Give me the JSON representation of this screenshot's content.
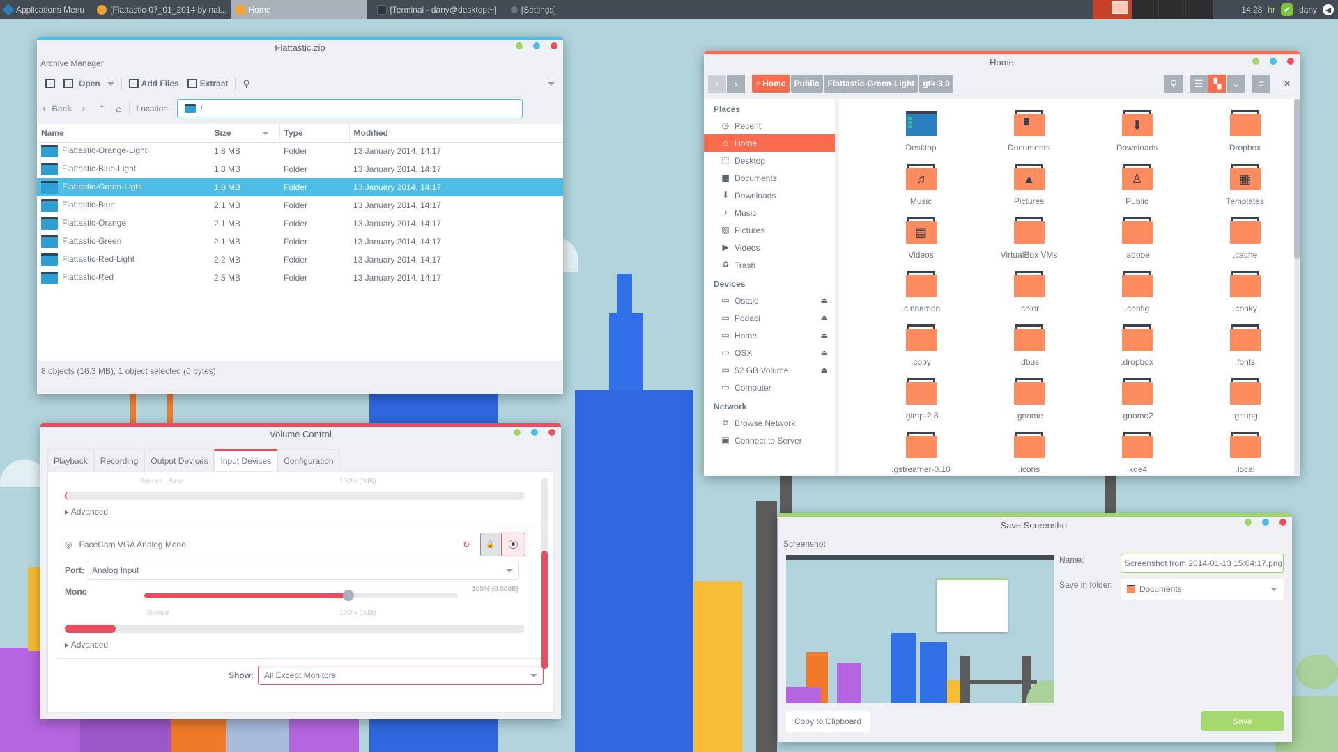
{
  "panel": {
    "apps_menu": "Applications Menu",
    "tasks": [
      {
        "label": "[Flattastic-07_01_2014 by nal...",
        "icon": "chrome-icon",
        "active": false
      },
      {
        "label": "Home",
        "icon": "folder-icon",
        "active": true
      },
      {
        "label": "[Terminal - dany@desktop:~]",
        "icon": "terminal-icon",
        "active": false
      },
      {
        "label": "[Settings]",
        "icon": "settings-icon",
        "active": false
      }
    ],
    "clock": "14:28",
    "keyboard_layout": "hr",
    "user": "dany"
  },
  "archive": {
    "title": "Flattastic.zip",
    "subtitle": "Archive Manager",
    "toolbar": {
      "open": "Open",
      "add_files": "Add Files",
      "extract": "Extract"
    },
    "nav": {
      "back": "Back",
      "location_label": "Location:",
      "location_value": "/"
    },
    "columns": [
      "Name",
      "Size",
      "Type",
      "Modified"
    ],
    "rows": [
      {
        "name": "Flattastic-Orange-Light",
        "size": "1.8 MB",
        "type": "Folder",
        "modified": "13 January 2014, 14:17"
      },
      {
        "name": "Flattastic-Blue-Light",
        "size": "1.8 MB",
        "type": "Folder",
        "modified": "13 January 2014, 14:17"
      },
      {
        "name": "Flattastic-Green-Light",
        "size": "1.8 MB",
        "type": "Folder",
        "modified": "13 January 2014, 14:17",
        "selected": true
      },
      {
        "name": "Flattastic-Blue",
        "size": "2.1 MB",
        "type": "Folder",
        "modified": "13 January 2014, 14:17"
      },
      {
        "name": "Flattastic-Orange",
        "size": "2.1 MB",
        "type": "Folder",
        "modified": "13 January 2014, 14:17"
      },
      {
        "name": "Flattastic-Green",
        "size": "2.1 MB",
        "type": "Folder",
        "modified": "13 January 2014, 14:17"
      },
      {
        "name": "Flattastic-Red-Light",
        "size": "2.2 MB",
        "type": "Folder",
        "modified": "13 January 2014, 14:17"
      },
      {
        "name": "Flattastic-Red",
        "size": "2.5 MB",
        "type": "Folder",
        "modified": "13 January 2014, 14:17"
      }
    ],
    "status": "8 objects (16.3 MB), 1 object selected (0 bytes)"
  },
  "files": {
    "title": "Home",
    "breadcrumbs": [
      "Home",
      "Public",
      "Flattastic-Green-Light",
      "gtk-3.0"
    ],
    "sidebar": {
      "places_header": "Places",
      "places": [
        {
          "label": "Recent",
          "icon": "clock-icon"
        },
        {
          "label": "Home",
          "icon": "home-icon",
          "selected": true
        },
        {
          "label": "Desktop",
          "icon": "desktop-icon"
        },
        {
          "label": "Documents",
          "icon": "document-icon"
        },
        {
          "label": "Downloads",
          "icon": "download-icon"
        },
        {
          "label": "Music",
          "icon": "music-icon"
        },
        {
          "label": "Pictures",
          "icon": "picture-icon"
        },
        {
          "label": "Videos",
          "icon": "video-icon"
        },
        {
          "label": "Trash",
          "icon": "trash-icon"
        }
      ],
      "devices_header": "Devices",
      "devices": [
        {
          "label": "Ostalo",
          "eject": true
        },
        {
          "label": "Podaci",
          "eject": true
        },
        {
          "label": "Home",
          "eject": true
        },
        {
          "label": "OSX",
          "eject": true
        },
        {
          "label": "52 GB Volume",
          "eject": true
        },
        {
          "label": "Computer",
          "eject": false
        }
      ],
      "network_header": "Network",
      "network": [
        {
          "label": "Browse Network",
          "icon": "network-icon"
        },
        {
          "label": "Connect to Server",
          "icon": "server-icon"
        }
      ]
    },
    "items": [
      {
        "label": "Desktop",
        "glyph": "desktop"
      },
      {
        "label": "Documents",
        "glyph": "▘"
      },
      {
        "label": "Downloads",
        "glyph": "⬇"
      },
      {
        "label": "Dropbox",
        "glyph": ""
      },
      {
        "label": "Music",
        "glyph": "♫"
      },
      {
        "label": "Pictures",
        "glyph": "▲"
      },
      {
        "label": "Public",
        "glyph": "♙"
      },
      {
        "label": "Templates",
        "glyph": "▦"
      },
      {
        "label": "Videos",
        "glyph": "▤"
      },
      {
        "label": "VirtualBox VMs",
        "glyph": ""
      },
      {
        "label": ".adobe",
        "glyph": ""
      },
      {
        "label": ".cache",
        "glyph": ""
      },
      {
        "label": ".cinnamon",
        "glyph": ""
      },
      {
        "label": ".color",
        "glyph": ""
      },
      {
        "label": ".config",
        "glyph": ""
      },
      {
        "label": ".conky",
        "glyph": ""
      },
      {
        "label": ".copy",
        "glyph": ""
      },
      {
        "label": ".dbus",
        "glyph": ""
      },
      {
        "label": ".dropbox",
        "glyph": ""
      },
      {
        "label": ".fonts",
        "glyph": ""
      },
      {
        "label": ".gimp-2.8",
        "glyph": ""
      },
      {
        "label": ".gnome",
        "glyph": ""
      },
      {
        "label": ".gnome2",
        "glyph": ""
      },
      {
        "label": ".gnupg",
        "glyph": ""
      },
      {
        "label": ".gstreamer-0.10",
        "glyph": ""
      },
      {
        "label": ".icons",
        "glyph": ""
      },
      {
        "label": ".kde4",
        "glyph": ""
      },
      {
        "label": ".local",
        "glyph": ""
      }
    ]
  },
  "volume": {
    "title": "Volume Control",
    "tabs": [
      "Playback",
      "Recording",
      "Output Devices",
      "Input Devices",
      "Configuration"
    ],
    "active_tab": "Input Devices",
    "top_scale": {
      "silence": "Silence",
      "base": "Base",
      "full": "100% (0dB)"
    },
    "advanced": "Advanced",
    "device_name": "FaceCam VGA Analog Mono",
    "port_label": "Port:",
    "port_value": "Analog Input",
    "channel_label": "Mono",
    "volume_readout": "100% (0.00dB)",
    "volume_fraction": 0.65,
    "scale_silence": "Silence",
    "scale_full": "100% (0dB)",
    "level_fraction": 0.11,
    "show_label": "Show:",
    "show_value": "All Except Monitors"
  },
  "screenshot": {
    "title": "Save Screenshot",
    "section": "Screenshot",
    "name_label": "Name:",
    "name_value": "Screenshot from 2014-01-13 15:04:17.png",
    "folder_label": "Save in folder:",
    "folder_value": "Documents",
    "copy_button": "Copy to Clipboard",
    "save_button": "Save"
  }
}
